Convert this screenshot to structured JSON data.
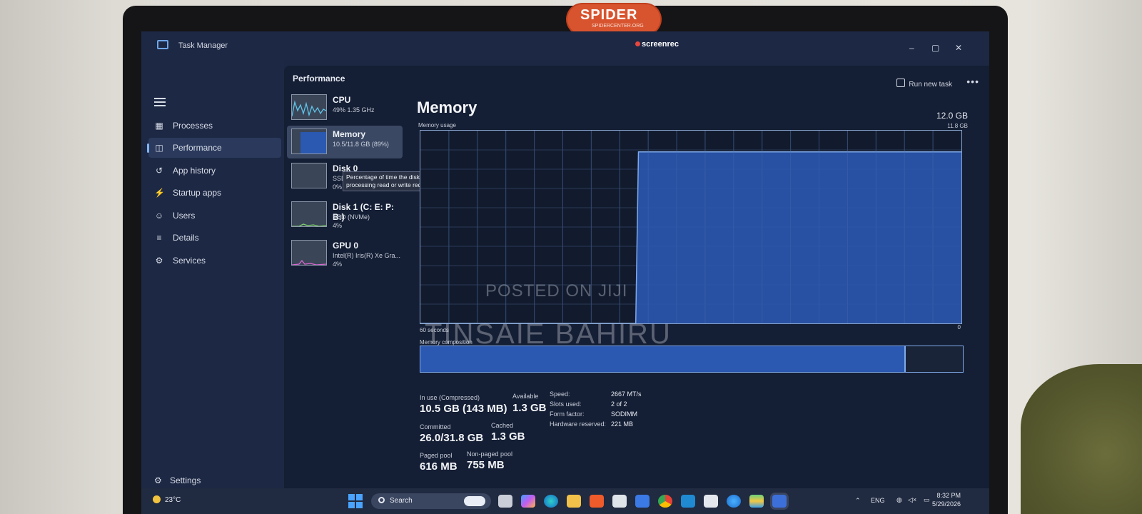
{
  "window": {
    "title": "Task Manager",
    "recorder": "screenrec",
    "controls": {
      "minimize": "–",
      "maximize": "▢",
      "close": "✕"
    }
  },
  "logo": {
    "text": "SPIDER",
    "sub": "SPIDERCENTER.ORG"
  },
  "sidebar": {
    "items": [
      {
        "label": "Processes",
        "icon": "processes-icon"
      },
      {
        "label": "Performance",
        "icon": "performance-icon",
        "active": true
      },
      {
        "label": "App history",
        "icon": "history-icon"
      },
      {
        "label": "Startup apps",
        "icon": "startup-icon"
      },
      {
        "label": "Users",
        "icon": "users-icon"
      },
      {
        "label": "Details",
        "icon": "details-icon"
      },
      {
        "label": "Services",
        "icon": "services-icon"
      }
    ],
    "settings": "Settings"
  },
  "header": {
    "title": "Performance",
    "run_new_task": "Run new task",
    "more": "•••"
  },
  "devices": [
    {
      "name": "CPU",
      "sub1": "49% 1.35 GHz",
      "sub2": ""
    },
    {
      "name": "Memory",
      "sub1": "10.5/11.8 GB (89%)",
      "sub2": "",
      "active": true
    },
    {
      "name": "Disk 0",
      "sub1": "SSD",
      "sub2": "0%"
    },
    {
      "name": "Disk 1 (C: E: P: B:)",
      "sub1": "SSD (NVMe)",
      "sub2": "4%"
    },
    {
      "name": "GPU 0",
      "sub1": "Intel(R) Iris(R) Xe Gra...",
      "sub2": "4%"
    }
  ],
  "tooltip": "Percentage of time the disk is processing read or write requests",
  "memory": {
    "title": "Memory",
    "total": "12.0 GB",
    "usage_label": "Memory usage",
    "usage_max": "11.8 GB",
    "seconds_label": "60 seconds",
    "zero_label": "0",
    "composition_label": "Memory composition",
    "composition_in_use_fraction": 0.895,
    "usage_history": [
      0,
      0,
      0,
      0,
      0,
      0,
      0,
      0,
      0,
      0,
      0,
      0,
      0,
      0,
      0,
      0,
      0,
      0,
      0,
      0,
      0,
      0,
      0,
      0,
      0,
      0,
      0,
      0,
      0,
      0,
      0,
      0,
      0,
      0,
      0,
      0,
      0,
      0,
      0,
      0,
      0,
      0,
      0,
      0,
      0,
      0,
      0,
      0,
      0,
      0,
      0,
      0,
      0,
      0,
      0,
      0,
      0,
      0,
      0,
      0,
      0,
      0,
      0,
      0,
      0,
      0,
      0,
      0,
      0,
      0,
      0,
      0,
      0,
      0,
      0,
      0,
      0,
      0,
      0,
      10.5,
      10.5,
      10.5,
      10.5,
      10.5,
      10.5,
      10.5,
      10.5,
      10.5,
      10.5,
      10.5,
      10.5,
      10.5,
      10.5,
      10.5,
      10.5,
      10.5,
      10.5,
      10.5,
      10.5,
      10.5,
      10.5,
      10.5,
      10.5,
      10.5,
      10.5,
      10.5,
      10.5,
      10.5,
      10.5,
      10.5,
      10.5,
      10.5,
      10.5,
      10.5,
      10.5,
      10.5,
      10.5,
      10.5,
      10.5,
      10.5,
      10.5,
      10.5,
      10.5,
      10.5,
      10.5,
      10.5,
      10.5,
      10.5,
      10.5,
      10.5,
      10.5,
      10.5,
      10.5,
      10.5,
      10.5,
      10.5,
      10.5,
      10.5,
      10.5,
      10.5,
      10.5,
      10.5,
      10.5,
      10.5,
      10.5,
      10.5,
      10.5,
      10.5,
      10.5,
      10.5,
      10.5,
      10.5,
      10.5,
      10.5,
      10.5,
      10.5,
      10.5,
      10.5,
      10.5,
      10.5,
      10.5,
      10.5,
      10.5,
      10.5,
      10.5,
      10.5,
      10.5,
      10.5,
      10.5,
      10.5,
      10.5,
      10.5,
      10.5,
      10.5,
      10.5,
      10.5,
      10.5,
      10.5,
      10.5,
      10.5,
      10.5,
      10.5,
      10.5,
      10.5,
      10.5,
      10.5,
      10.5,
      10.5,
      10.5,
      10.5,
      10.5,
      10.5,
      10.5,
      10.5,
      10.5,
      10.5,
      10.5
    ],
    "stats": {
      "in_use_label": "In use (Compressed)",
      "in_use": "10.5 GB (143 MB)",
      "available_label": "Available",
      "available": "1.3 GB",
      "committed_label": "Committed",
      "committed": "26.0/31.8 GB",
      "cached_label": "Cached",
      "cached": "1.3 GB",
      "paged_label": "Paged pool",
      "paged": "616 MB",
      "nonpaged_label": "Non-paged pool",
      "nonpaged": "755 MB"
    },
    "details": {
      "speed_label": "Speed:",
      "speed": "2667 MT/s",
      "slots_label": "Slots used:",
      "slots": "2 of 2",
      "form_label": "Form factor:",
      "form": "SODIMM",
      "reserved_label": "Hardware reserved:",
      "reserved": "221 MB"
    }
  },
  "watermarks": {
    "posted": "POSTED ON JIJI",
    "name": "TINSAIE BAHIRU"
  },
  "taskbar": {
    "weather": "23°C",
    "search": "Search",
    "tray_lang": "ENG",
    "time": "8:32 PM",
    "date": "5/29/2026",
    "colors": {
      "accent": "#2b58b0",
      "line": "#7fa9e8"
    }
  }
}
